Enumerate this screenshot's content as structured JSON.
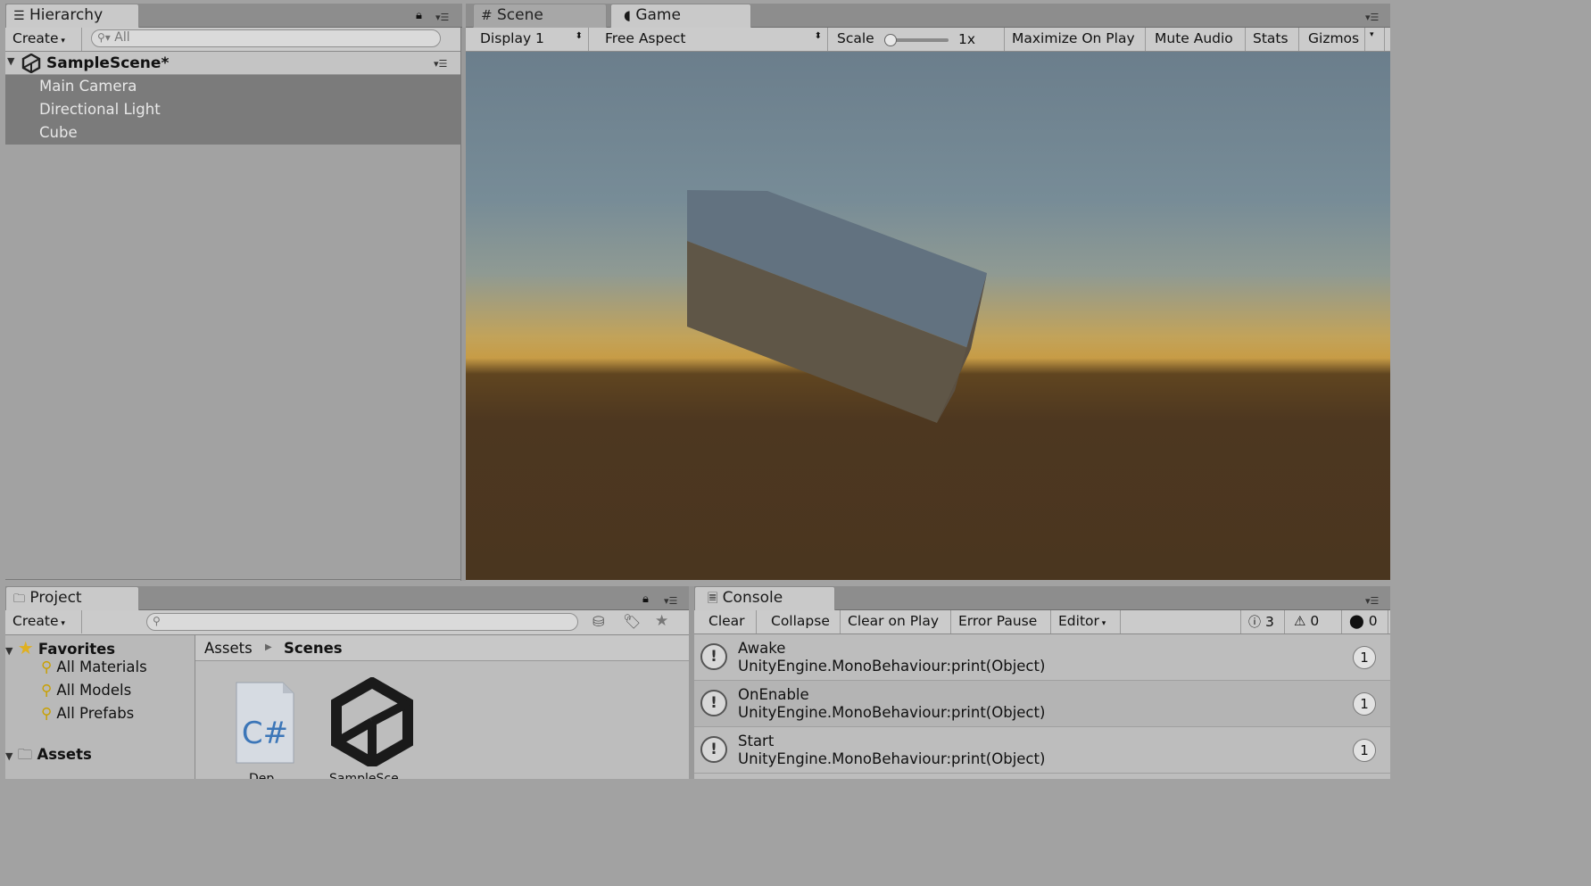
{
  "hierarchy": {
    "tab_label": "Hierarchy",
    "create_label": "Create",
    "search_placeholder": "All",
    "scene_name": "SampleScene*",
    "items": [
      {
        "label": "Main Camera"
      },
      {
        "label": "Directional Light"
      },
      {
        "label": "Cube"
      }
    ]
  },
  "view_tabs": {
    "scene_label": "Scene",
    "game_label": "Game"
  },
  "game_toolbar": {
    "display": "Display 1",
    "aspect": "Free Aspect",
    "scale_label": "Scale",
    "scale_value": "1x",
    "maximize_label": "Maximize On Play",
    "mute_label": "Mute Audio",
    "stats_label": "Stats",
    "gizmos_label": "Gizmos"
  },
  "project": {
    "tab_label": "Project",
    "create_label": "Create",
    "favorites_label": "Favorites",
    "favorites": [
      {
        "label": "All Materials"
      },
      {
        "label": "All Models"
      },
      {
        "label": "All Prefabs"
      }
    ],
    "assets_label": "Assets",
    "breadcrumb_root": "Assets",
    "breadcrumb_current": "Scenes",
    "files": [
      {
        "icon": "csharp-script-icon",
        "glyph": "C#",
        "label": "Dep"
      },
      {
        "icon": "unity-scene-icon",
        "label": "SampleSce"
      }
    ]
  },
  "console": {
    "tab_label": "Console",
    "clear_label": "Clear",
    "collapse_label": "Collapse",
    "clear_on_play_label": "Clear on Play",
    "error_pause_label": "Error Pause",
    "editor_label": "Editor",
    "info_count": "3",
    "warning_count": "0",
    "error_count": "0",
    "entries": [
      {
        "title": "Awake",
        "detail": "UnityEngine.MonoBehaviour:print(Object)",
        "count": "1"
      },
      {
        "title": "OnEnable",
        "detail": "UnityEngine.MonoBehaviour:print(Object)",
        "count": "1"
      },
      {
        "title": "Start",
        "detail": "UnityEngine.MonoBehaviour:print(Object)",
        "count": "1"
      }
    ]
  },
  "colors": {
    "hierarchy_selection": "#7b7b7b",
    "sky_top": "#6b7e8c",
    "horizon": "#c79c46",
    "ground": "#4a361f",
    "cube_top": "#657480",
    "cube_front": "#62584a"
  }
}
